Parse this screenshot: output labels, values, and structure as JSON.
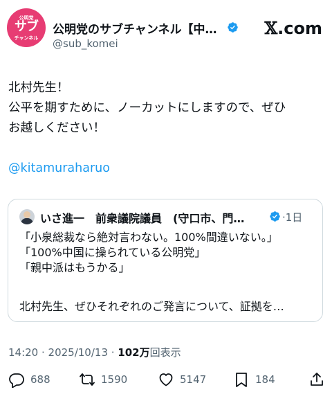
{
  "author": {
    "avatar_line1": "公明党",
    "avatar_line2": "サブ",
    "avatar_line3": "チャンネル",
    "display_name": "公明党のサブチャンネル【中…",
    "handle": "@sub_komei",
    "verified_icon": "verified-badge-icon",
    "verified_color": "#1d9bf0"
  },
  "brand": {
    "x_glyph": "𝕏",
    "x_suffix": ".com"
  },
  "post": {
    "lines": [
      "北村先生！",
      "公平を期すために、ノーカットにしますので、ぜひ",
      "お越しください！"
    ],
    "mention": "@kitamuraharuo"
  },
  "quote": {
    "author_name": "いさ進一　前衆議院議員　(守口市、門…",
    "time": "·1日",
    "lines": [
      "「小泉総裁なら絶対言わない。100%間違いない。」",
      "「100%中国に操られている公明党」",
      "「親中派はもうかる」"
    ],
    "last_line": "北村先生、ぜひそれぞれのご発言について、証拠を…"
  },
  "meta": {
    "time_date": "14:20 · 2025/10/13 · ",
    "views_count": "102万",
    "views_label": "回表示"
  },
  "actions": {
    "replies": "688",
    "reposts": "1590",
    "likes": "5147",
    "bookmarks": "184",
    "icons": [
      "reply-icon",
      "repost-icon",
      "like-icon",
      "bookmark-icon",
      "share-icon"
    ]
  },
  "colors": {
    "accent": "#1d9bf0",
    "text": "#0f1419",
    "secondary": "#536471",
    "border": "#cfd9de",
    "brand_pink": "#e73c73"
  }
}
